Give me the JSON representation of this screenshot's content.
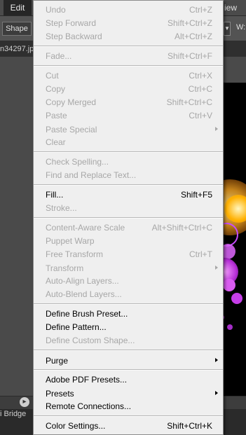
{
  "app": {
    "menubar_edit": "Edit",
    "menubar_view": "iew",
    "shape_button": "Shape",
    "options_w": "W:",
    "doc_tab": "n34297.jp",
    "bridge_tab": "i Bridge"
  },
  "edit_menu": {
    "undo": {
      "label": "Undo",
      "shortcut": "Ctrl+Z"
    },
    "step_forward": {
      "label": "Step Forward",
      "shortcut": "Shift+Ctrl+Z"
    },
    "step_backward": {
      "label": "Step Backward",
      "shortcut": "Alt+Ctrl+Z"
    },
    "fade": {
      "label": "Fade...",
      "shortcut": "Shift+Ctrl+F"
    },
    "cut": {
      "label": "Cut",
      "shortcut": "Ctrl+X"
    },
    "copy": {
      "label": "Copy",
      "shortcut": "Ctrl+C"
    },
    "copy_merged": {
      "label": "Copy Merged",
      "shortcut": "Shift+Ctrl+C"
    },
    "paste": {
      "label": "Paste",
      "shortcut": "Ctrl+V"
    },
    "paste_special": {
      "label": "Paste Special"
    },
    "clear": {
      "label": "Clear"
    },
    "check_spelling": {
      "label": "Check Spelling..."
    },
    "find_replace": {
      "label": "Find and Replace Text..."
    },
    "fill": {
      "label": "Fill...",
      "shortcut": "Shift+F5"
    },
    "stroke": {
      "label": "Stroke..."
    },
    "content_aware_scale": {
      "label": "Content-Aware Scale",
      "shortcut": "Alt+Shift+Ctrl+C"
    },
    "puppet_warp": {
      "label": "Puppet Warp"
    },
    "free_transform": {
      "label": "Free Transform",
      "shortcut": "Ctrl+T"
    },
    "transform": {
      "label": "Transform"
    },
    "auto_align": {
      "label": "Auto-Align Layers..."
    },
    "auto_blend": {
      "label": "Auto-Blend Layers..."
    },
    "define_brush": {
      "label": "Define Brush Preset..."
    },
    "define_pattern": {
      "label": "Define Pattern..."
    },
    "define_custom_shape": {
      "label": "Define Custom Shape..."
    },
    "purge": {
      "label": "Purge"
    },
    "adobe_pdf_presets": {
      "label": "Adobe PDF Presets..."
    },
    "presets": {
      "label": "Presets"
    },
    "remote_connections": {
      "label": "Remote Connections..."
    },
    "color_settings": {
      "label": "Color Settings...",
      "shortcut": "Shift+Ctrl+K"
    }
  },
  "colors": {
    "menu_bg": "#efefef",
    "enabled_text": "#000000",
    "disabled_text": "#a7a7a7",
    "app_bg": "#3a3a3a"
  }
}
